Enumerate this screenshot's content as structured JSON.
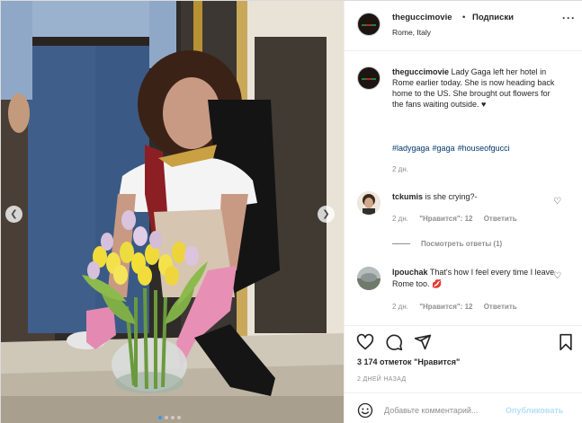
{
  "header": {
    "username": "theguccimovie",
    "separator": "•",
    "follow_label": "Подписки",
    "location": "Rome, Italy",
    "more_icon": "more-horizontal-icon",
    "avatar_text": "GUCCI"
  },
  "caption": {
    "username": "theguccimovie",
    "text": "Lady Gaga left her hotel in Rome earlier today. She is now heading back home to the US. She brought out flowers for the fans waiting outside. ♥",
    "hashtags": [
      "#ladygaga",
      "#gaga",
      "#houseofgucci"
    ],
    "time": "2 дн."
  },
  "comments": [
    {
      "username": "tckumis",
      "text": "is she crying?-",
      "time": "2 дн.",
      "likes_label": "\"Нравится\": 12",
      "reply_label": "Ответить",
      "view_replies": "Посмотреть ответы (1)"
    },
    {
      "username": "lpouchak",
      "text": "That's how I feel every time I leave Rome too. 💋",
      "time": "2 дн.",
      "likes_label": "\"Нравится\": 12",
      "reply_label": "Ответить"
    }
  ],
  "actions": {
    "like_icon": "heart-icon",
    "comment_icon": "comment-icon",
    "share_icon": "share-icon",
    "save_icon": "bookmark-icon"
  },
  "likes": {
    "count": "3 174",
    "text": "отметок \"Нравится\""
  },
  "posted_ago": "2 ДНЕЙ НАЗАД",
  "add_comment": {
    "placeholder": "Добавьте комментарий...",
    "publish_label": "Опубликовать"
  },
  "carousel": {
    "slides": 4,
    "active_index": 0
  },
  "colors": {
    "link": "#00376b",
    "publish_disabled": "#b2dffc",
    "muted": "#8e8e8e",
    "active_dot": "#3897f0"
  }
}
